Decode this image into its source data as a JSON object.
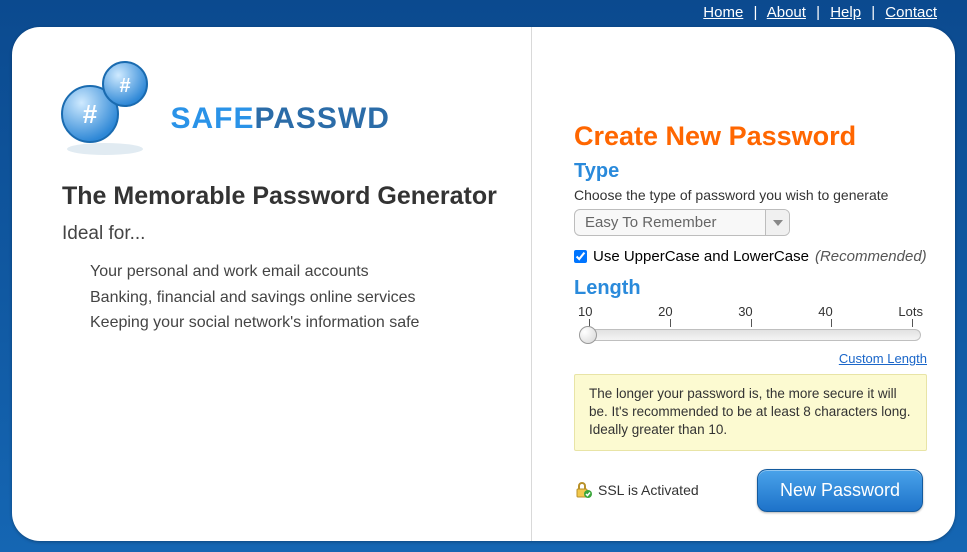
{
  "nav": {
    "home": "Home",
    "about": "About",
    "help": "Help",
    "contact": "Contact"
  },
  "logo": {
    "part1": "SAFE",
    "part2": "PASSWD"
  },
  "tagline": "The Memorable Password Generator",
  "ideal_label": "Ideal for...",
  "ideal_items": [
    "Your personal and work email accounts",
    "Banking, financial and savings online services",
    "Keeping your social network's information safe"
  ],
  "create_heading": "Create New Password",
  "type": {
    "label": "Type",
    "helper": "Choose the type of password you wish to generate",
    "selected": "Easy To Remember"
  },
  "case_checkbox": {
    "checked": true,
    "label": "Use UpperCase and LowerCase",
    "hint": "(Recommended)"
  },
  "length": {
    "label": "Length",
    "ticks": [
      "10",
      "20",
      "30",
      "40",
      "Lots"
    ],
    "custom_link": "Custom Length",
    "info": "The longer your password is, the more secure it will be. It's recommended to be at least 8 characters long. Ideally greater than 10."
  },
  "ssl_text": "SSL is Activated",
  "new_password_button": "New Password"
}
